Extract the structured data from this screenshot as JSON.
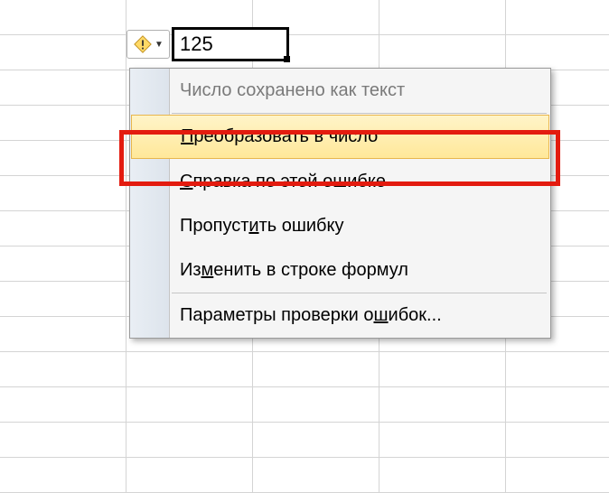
{
  "cell": {
    "value": "125"
  },
  "menu": {
    "header": "Число сохранено как текст",
    "convert": "Преобразовать в число",
    "help": "Справка по этой ошибке",
    "skip": "Пропустить ошибку",
    "edit": "Изменить в строке формул",
    "options": "Параметры проверки ошибок..."
  },
  "underline_chars": {
    "convert": "П",
    "help": "С",
    "skip_part1": "Пропуст",
    "skip_u": "и",
    "skip_part2": "ть ошибку",
    "edit_part1": "Из",
    "edit_u": "м",
    "edit_part2": "енить в строке формул",
    "options_part1": "Параметры проверки о",
    "options_u": "ш",
    "options_part2": "ибок..."
  }
}
